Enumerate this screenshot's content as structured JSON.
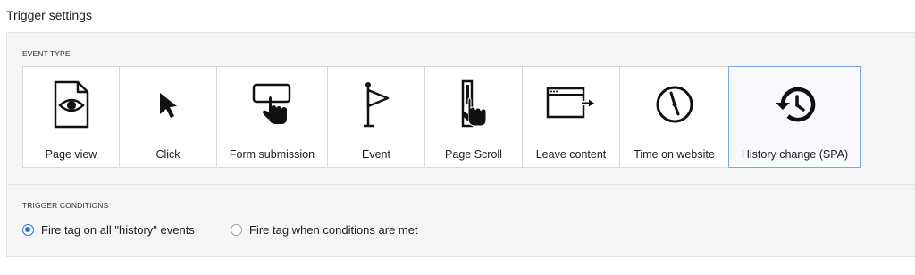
{
  "header": {
    "title": "Trigger settings"
  },
  "event_type": {
    "section_label": "EVENT TYPE",
    "selected": "History change (SPA)",
    "tiles": [
      {
        "label": "Page view",
        "icon": "page-view-icon"
      },
      {
        "label": "Click",
        "icon": "cursor-arrow-icon"
      },
      {
        "label": "Form submission",
        "icon": "form-submit-icon"
      },
      {
        "label": "Event",
        "icon": "flag-icon"
      },
      {
        "label": "Page Scroll",
        "icon": "page-scroll-icon"
      },
      {
        "label": "Leave content",
        "icon": "leave-content-icon"
      },
      {
        "label": "Time on website",
        "icon": "clock-icon"
      },
      {
        "label": "History change (SPA)",
        "icon": "history-icon"
      }
    ]
  },
  "trigger_conditions": {
    "section_label": "TRIGGER CONDITIONS",
    "options": [
      {
        "label": "Fire tag on all \"history\" events",
        "checked": true
      },
      {
        "label": "Fire tag when conditions are met",
        "checked": false
      }
    ]
  },
  "colors": {
    "accent": "#1a73e8",
    "selected_border": "#7aa7ea",
    "panel_bg": "#f5f5f5"
  }
}
